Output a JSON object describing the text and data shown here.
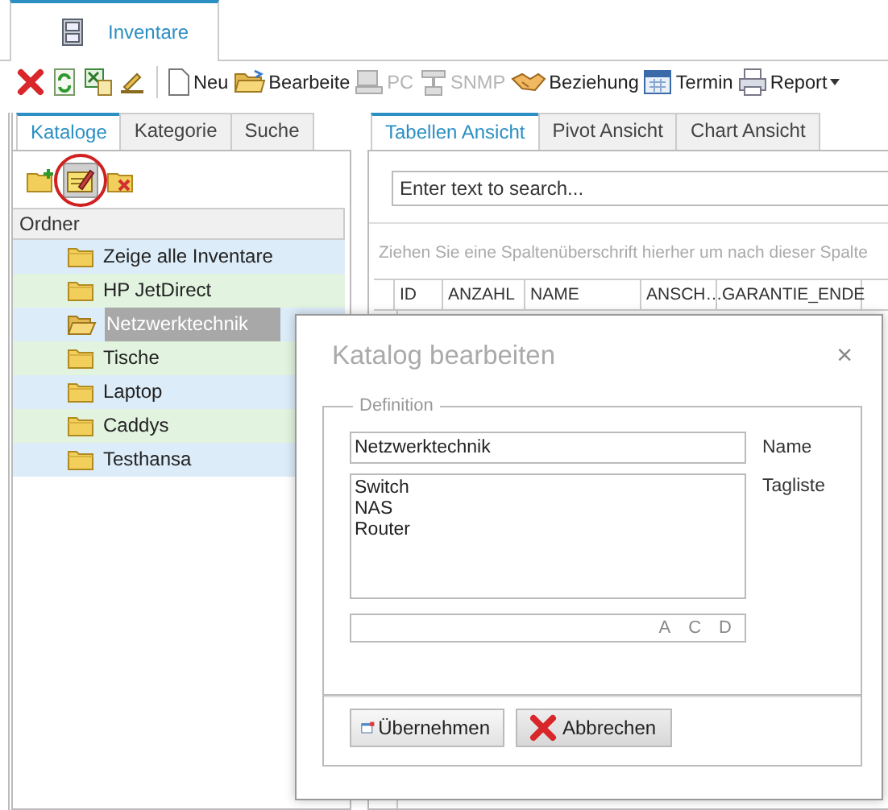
{
  "app_tab": {
    "label": "Inventare",
    "selected": true
  },
  "toolbar": {
    "icon_buttons": [
      {
        "disabled": false
      },
      {
        "disabled": false
      },
      {
        "disabled": false
      },
      {
        "disabled": false
      }
    ],
    "buttons": [
      {
        "label": "Neu",
        "disabled": false
      },
      {
        "label": "Bearbeite",
        "disabled": false
      },
      {
        "label": "PC",
        "disabled": true
      },
      {
        "label": "SNMP",
        "disabled": true
      },
      {
        "label": "Beziehung",
        "disabled": false
      },
      {
        "label": "Termin",
        "disabled": false
      },
      {
        "label": "Report",
        "disabled": false,
        "dropdown": true
      }
    ]
  },
  "left_tabs": [
    {
      "label": "Kataloge",
      "selected": true
    },
    {
      "label": "Kategorie",
      "selected": false
    },
    {
      "label": "Suche",
      "selected": false
    }
  ],
  "catalog_tools": [
    {
      "highlighted": false
    },
    {
      "highlighted": true
    },
    {
      "highlighted": false
    }
  ],
  "folder_tree": {
    "header": "Ordner",
    "items": [
      {
        "label": "Zeige alle Inventare",
        "selected": false
      },
      {
        "label": "HP JetDirect",
        "selected": false
      },
      {
        "label": "Netzwerktechnik",
        "selected": true
      },
      {
        "label": "Tische",
        "selected": false
      },
      {
        "label": "Laptop",
        "selected": false
      },
      {
        "label": "Caddys",
        "selected": false
      },
      {
        "label": "Testhansa",
        "selected": false
      }
    ]
  },
  "right_tabs": [
    {
      "label": "Tabellen Ansicht",
      "selected": true
    },
    {
      "label": "Pivot Ansicht",
      "selected": false
    },
    {
      "label": "Chart Ansicht",
      "selected": false
    }
  ],
  "search": {
    "placeholder": "Enter text to search..."
  },
  "group_hint": "Ziehen Sie eine Spaltenüberschrift hierher um nach dieser Spalte",
  "table": {
    "columns": [
      "ID",
      "ANZAHL",
      "NAME",
      "ANSCH…",
      "GARANTIE_ENDE"
    ]
  },
  "dialog": {
    "title": "Katalog bearbeiten",
    "close": "×",
    "section": "Definition",
    "name_field": {
      "value": "Netzwerktechnik",
      "label": "Name"
    },
    "tags_field": {
      "lines": [
        "Switch",
        "NAS",
        "Router"
      ],
      "label": "Tagliste"
    },
    "tag_letters": [
      "A",
      "C",
      "D"
    ],
    "buttons": [
      {
        "label": "Übernehmen"
      },
      {
        "label": "Abbrechen"
      }
    ]
  }
}
